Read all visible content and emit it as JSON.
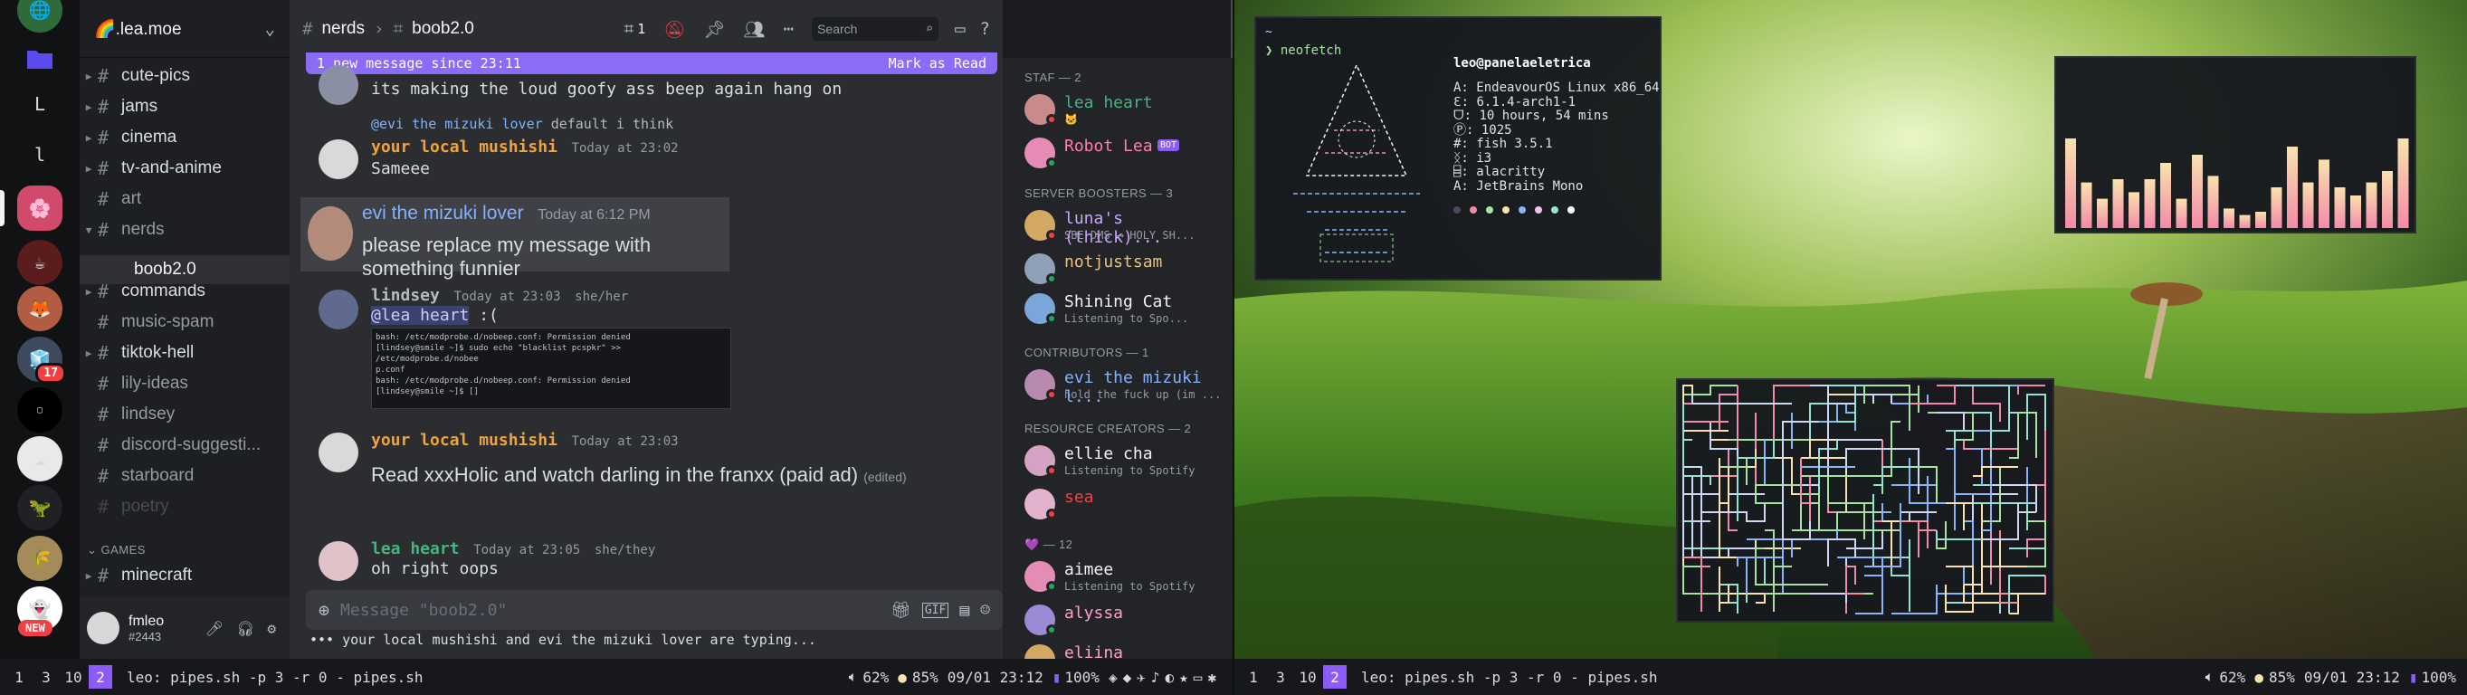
{
  "discord": {
    "guild_name": "🌈.lea.moe",
    "channels": [
      {
        "name": "cute-pics",
        "arrow": "▶",
        "bright": true
      },
      {
        "name": "jams",
        "arrow": "▶",
        "bright": true
      },
      {
        "name": "cinema",
        "arrow": "▶",
        "bright": true
      },
      {
        "name": "tv-and-anime",
        "arrow": "▶",
        "bright": true
      },
      {
        "name": "art",
        "arrow": "",
        "bright": false
      },
      {
        "name": "nerds",
        "arrow": "▼",
        "bright": false
      },
      {
        "name": "commands",
        "arrow": "▶",
        "bright": true
      },
      {
        "name": "music-spam",
        "arrow": "",
        "bright": false
      },
      {
        "name": "tiktok-hell",
        "arrow": "▶",
        "bright": true
      },
      {
        "name": "lily-ideas",
        "arrow": "",
        "bright": false
      },
      {
        "name": "lindsey",
        "arrow": "",
        "bright": false
      },
      {
        "name": "discord-suggesti...",
        "arrow": "",
        "bright": false
      },
      {
        "name": "starboard",
        "arrow": "",
        "bright": false
      },
      {
        "name": "poetry",
        "arrow": "",
        "bright": false
      }
    ],
    "thread_name": "boob2.0",
    "category_games": "GAMES",
    "games_channel": "minecraft",
    "user": {
      "name": "fmleo",
      "tag": "#2443"
    },
    "server_badge": "17",
    "new_badge": "NEW",
    "server_letters": [
      "L",
      "l"
    ],
    "header": {
      "channel": "nerds",
      "thread": "boob2.0",
      "thread_count": "1",
      "search_placeholder": "Search"
    },
    "new_messages_bar": {
      "text": "1 new message since 23:11",
      "action": "Mark as Read"
    },
    "messages": [
      {
        "text": "its making the loud goofy ass beep again hang on"
      },
      {
        "reply_to": "@evi the mizuki lover",
        "reply_text": "default i think",
        "author": "your local mushishi",
        "time": "Today at 23:02",
        "text": "Sameee"
      },
      {
        "author": "evi the mizuki lover",
        "time": "Today at 6:12 PM",
        "text": "please replace my message with something funnier"
      },
      {
        "author": "lindsey",
        "time": "Today at 23:03",
        "pronouns": "she/her",
        "mention": "@lea heart",
        "text": " :("
      },
      {
        "author": "your local mushishi",
        "time": "Today at 23:03",
        "text": "Read xxxHolic and watch darling in the franxx (paid ad)",
        "edited": "(edited)"
      },
      {
        "author": "lea heart",
        "time": "Today at 23:05",
        "pronouns": "she/they",
        "text": "oh right oops"
      }
    ],
    "code_screenshot": [
      "bash: /etc/modprobe.d/nobeep.conf: Permission denied",
      "[lindsey@smile ~]$ sudo echo \"blacklist pcspkr\" >> /etc/modprobe.d/nobee",
      "p.conf",
      "bash: /etc/modprobe.d/nobeep.conf: Permission denied",
      "[lindsey@smile ~]$ []"
    ],
    "composer_placeholder": "Message \"boob2.0\"",
    "typing": "your local mushishi and evi the mizuki lover are typing...",
    "member_groups": [
      {
        "title": "STAF — 2",
        "members": [
          {
            "name": "lea heart",
            "sub": "🐱",
            "color": "#43b581",
            "status": "#f23f43"
          },
          {
            "name": "Robot Lea",
            "sub": "",
            "color": "#ff7ab2",
            "status": "#23a55a",
            "bot": "BOT"
          }
        ]
      },
      {
        "title": "SERVER BOOSTERS — 3",
        "members": [
          {
            "name": "luna's (thick)...",
            "sub": "SBE DMS ⟶ HOLY SH...",
            "color": "#c9a6ff",
            "status": "#f23f43"
          },
          {
            "name": "notjustsam",
            "sub": "",
            "color": "#e8c27c",
            "status": "#23a55a"
          },
          {
            "name": "Shining Cat",
            "sub": "Listening to Spo...",
            "color": "#f2f3f5",
            "status": "#23a55a"
          }
        ]
      },
      {
        "title": "CONTRIBUTORS — 1",
        "members": [
          {
            "name": "evi the mizuki l...",
            "sub": "hold the fuck up (im ...",
            "color": "#7fb3ff",
            "status": "#f23f43"
          }
        ]
      },
      {
        "title": "RESOURCE CREATORS — 2",
        "members": [
          {
            "name": "ellie cha",
            "sub": "Listening to Spotify",
            "color": "#f2f3f5",
            "status": "#f23f43"
          },
          {
            "name": "sea",
            "sub": "",
            "color": "#f23f43",
            "status": "#f23f43"
          }
        ]
      },
      {
        "title": "💜 — 12",
        "members": [
          {
            "name": "aimee",
            "sub": "Listening to Spotify",
            "color": "#f2f3f5",
            "status": "#23a55a"
          },
          {
            "name": "alyssa",
            "sub": "",
            "color": "#ff9fd0",
            "status": "#23a55a"
          },
          {
            "name": "eliina",
            "sub": "",
            "color": "#ff9fd0",
            "status": "#23a55a"
          }
        ]
      }
    ]
  },
  "bar_left": {
    "workspaces": [
      "1",
      "3",
      "10",
      "2"
    ],
    "title": "leo: pipes.sh -p 3 -r 0 - pipes.sh",
    "volume": "62%",
    "brightness": "85%",
    "datetime": "09/01 23:12",
    "battery": "100%"
  },
  "bar_right": {
    "workspaces": [
      "1",
      "3",
      "10",
      "2"
    ],
    "title": "leo: pipes.sh -p 3 -r 0 - pipes.sh",
    "volume": "62%",
    "brightness": "85%",
    "datetime": "09/01 23:12",
    "battery": "100%"
  },
  "neofetch": {
    "prompt_top": "~",
    "prompt": "❯ neofetch",
    "userhost": "leo@panelaeletrica",
    "lines": [
      "A: EndeavourOS Linux x86_64",
      "Ꜫ: 6.1.4-arch1-1",
      "ᗜ: 10 hours, 54 mins",
      "Ⓟ: 1025",
      "#: fish 3.5.1",
      "ᛝ: i3",
      "⌸: alacritty",
      "A: JetBrains Mono"
    ],
    "palette": [
      "#434c5e",
      "#f38ba8",
      "#a6e3a1",
      "#f9e2af",
      "#89b4fa",
      "#f5c2e7",
      "#94e2d5",
      "#ffffff"
    ]
  },
  "cava_levels": [
    0.55,
    0.28,
    0.18,
    0.3,
    0.22,
    0.3,
    0.4,
    0.18,
    0.45,
    0.32,
    0.12,
    0.08,
    0.1,
    0.25,
    0.5,
    0.28,
    0.42,
    0.25,
    0.2,
    0.28,
    0.35,
    0.55
  ]
}
